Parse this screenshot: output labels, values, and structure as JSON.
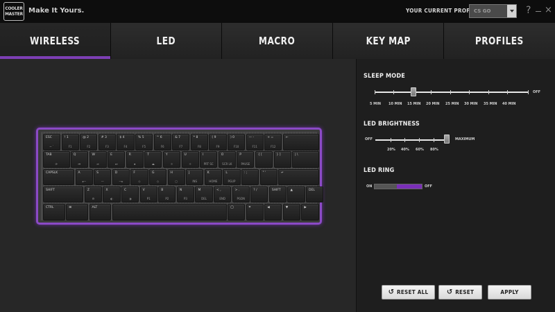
{
  "app": {
    "logo_text": "COOLER MASTER",
    "tagline": "Make It Yours.",
    "profile_label": "YOUR CURRENT PROFILE",
    "profile_value": "CS GO",
    "help_glyph": "?",
    "close_glyph": "×"
  },
  "tabs": [
    {
      "label": "WIRELESS",
      "active": true
    },
    {
      "label": "LED",
      "active": false
    },
    {
      "label": "MACRO",
      "active": false
    },
    {
      "label": "KEY MAP",
      "active": false
    },
    {
      "label": "PROFILES",
      "active": false
    }
  ],
  "sleep_mode": {
    "title": "SLEEP MODE",
    "options": [
      "5 MIN",
      "10 MIN",
      "15 MIN",
      "20 MIN",
      "25 MIN",
      "30 MIN",
      "35 MIN",
      "40 MIN",
      "OFF"
    ],
    "selected": "15 MIN"
  },
  "led_brightness": {
    "title": "LED BRIGHTNESS",
    "options": [
      "OFF",
      "20%",
      "40%",
      "60%",
      "80%",
      "MAXIMUM"
    ],
    "selected": "MAXIMUM"
  },
  "led_ring": {
    "title": "LED RING",
    "on_label": "ON",
    "off_label": "OFF",
    "state": "OFF"
  },
  "buttons": {
    "reset_all": "RESET ALL",
    "reset": "RESET",
    "apply": "APPLY"
  },
  "colors": {
    "accent": "#7d3fb5",
    "keyboard_glow": "#8b4ac6"
  },
  "keyboard": {
    "rows": [
      [
        {
          "t": "ESC",
          "b": "~ `"
        },
        {
          "t": "! 1",
          "b": "F1"
        },
        {
          "t": "@ 2",
          "b": "F2"
        },
        {
          "t": "# 3",
          "b": "F3"
        },
        {
          "t": "$ 4",
          "b": "F4"
        },
        {
          "t": "% 5",
          "b": "F5"
        },
        {
          "t": "^ 6",
          "b": "F6"
        },
        {
          "t": "& 7",
          "b": "F7"
        },
        {
          "t": "* 8",
          "b": "F8"
        },
        {
          "t": "( 9",
          "b": "F9"
        },
        {
          "t": ") 0",
          "b": "F10"
        },
        {
          "t": "— -",
          "b": "F11"
        },
        {
          "t": "+ =",
          "b": "F12"
        },
        {
          "t": "←",
          "b": ""
        }
      ],
      [
        {
          "t": "TAB",
          "b": "⟳"
        },
        {
          "t": "Q",
          "b": "⏮"
        },
        {
          "t": "W",
          "b": "⏯"
        },
        {
          "t": "E",
          "b": "⏭"
        },
        {
          "t": "R",
          "b": "⏹"
        },
        {
          "t": "T",
          "b": "⏏"
        },
        {
          "t": "Y",
          "b": "☼"
        },
        {
          "t": "U",
          "b": "☼"
        },
        {
          "t": "I",
          "b": "PRT SC"
        },
        {
          "t": "O",
          "b": "SCR LK"
        },
        {
          "t": "P",
          "b": "PAUSE"
        },
        {
          "t": "{ [",
          "b": ""
        },
        {
          "t": "} ]",
          "b": ""
        },
        {
          "t": "| \\",
          "b": ""
        }
      ],
      [
        {
          "t": "CAPSLK",
          "b": ""
        },
        {
          "t": "A",
          "b": "◂—"
        },
        {
          "t": "S",
          "b": "—"
        },
        {
          "t": "D",
          "b": "—▸"
        },
        {
          "t": "F",
          "b": "◇"
        },
        {
          "t": "G",
          "b": "◇"
        },
        {
          "t": "H",
          "b": "◻"
        },
        {
          "t": "J",
          "b": "INS"
        },
        {
          "t": "K",
          "b": "HOME"
        },
        {
          "t": "L",
          "b": "PGUP"
        },
        {
          "t": ": ;",
          "b": ""
        },
        {
          "t": "\" '",
          "b": ""
        },
        {
          "t": "↵",
          "b": ""
        }
      ],
      [
        {
          "t": "SHIFT",
          "b": ""
        },
        {
          "t": "Z",
          "b": "⚙"
        },
        {
          "t": "X",
          "b": "◐"
        },
        {
          "t": "C",
          "b": "◑"
        },
        {
          "t": "V",
          "b": "P1"
        },
        {
          "t": "B",
          "b": "P2"
        },
        {
          "t": "N",
          "b": "P3"
        },
        {
          "t": "M",
          "b": "DEL"
        },
        {
          "t": "< ,",
          "b": "END"
        },
        {
          "t": "> .",
          "b": "PGDN"
        },
        {
          "t": "? /",
          "b": ""
        },
        {
          "t": "SHIFT",
          "b": ""
        },
        {
          "t": "▲",
          "b": ""
        },
        {
          "t": "DEL",
          "b": ""
        }
      ],
      [
        {
          "t": "CTRL",
          "b": ""
        },
        {
          "t": "⊞",
          "b": ""
        },
        {
          "t": "ALT",
          "b": ""
        },
        {
          "t": "",
          "b": ""
        },
        {
          "t": "◯",
          "b": ""
        },
        {
          "t": "⌗",
          "b": ""
        },
        {
          "t": "◀",
          "b": ""
        },
        {
          "t": "▼",
          "b": ""
        },
        {
          "t": "▶",
          "b": ""
        }
      ]
    ]
  }
}
